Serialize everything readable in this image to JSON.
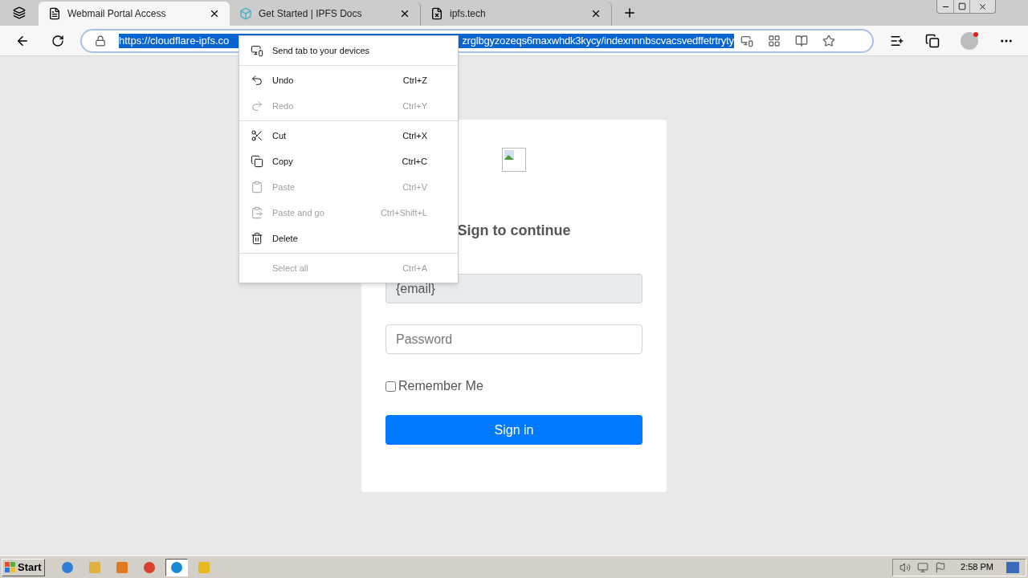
{
  "browser": {
    "tabs": [
      {
        "title": "Webmail Portal Access",
        "selected": true
      },
      {
        "title": "Get Started | IPFS Docs",
        "selected": false
      },
      {
        "title": "ipfs.tech",
        "selected": false
      }
    ],
    "address_bar": {
      "url_visible_start": "https://cloudflare-ipfs.co",
      "url_visible_end": "zrglbgyzozeqs6maxwhdk3kycy/indexnnnbscvacsvedffetrtryty"
    }
  },
  "context_menu": {
    "groups": [
      [
        {
          "label": "Send tab to your devices",
          "disabled": false
        }
      ],
      [
        {
          "label": "Undo",
          "shortcut": "Ctrl+Z",
          "disabled": false
        },
        {
          "label": "Redo",
          "shortcut": "Ctrl+Y",
          "disabled": true
        }
      ],
      [
        {
          "label": "Cut",
          "shortcut": "Ctrl+X",
          "disabled": false
        },
        {
          "label": "Copy",
          "shortcut": "Ctrl+C",
          "disabled": false
        },
        {
          "label": "Paste",
          "shortcut": "Ctrl+V",
          "disabled": true
        },
        {
          "label": "Paste and go",
          "shortcut": "Ctrl+Shift+L",
          "disabled": true
        },
        {
          "label": "Delete",
          "disabled": false
        }
      ],
      [
        {
          "label": "Select all",
          "shortcut": "Ctrl+A",
          "disabled": true
        }
      ]
    ]
  },
  "login": {
    "heading": "Sign to continue",
    "email": {
      "value": "{email}",
      "disabled": true
    },
    "password": {
      "placeholder": "Password"
    },
    "remember": {
      "label": "Remember Me",
      "checked": false
    },
    "submit": "Sign in"
  },
  "taskbar": {
    "start": "Start",
    "apps": [
      {
        "selected": false
      },
      {
        "selected": false
      },
      {
        "selected": false
      },
      {
        "selected": false
      },
      {
        "selected": true
      },
      {
        "selected": false
      }
    ],
    "clock": "2:58 PM"
  }
}
